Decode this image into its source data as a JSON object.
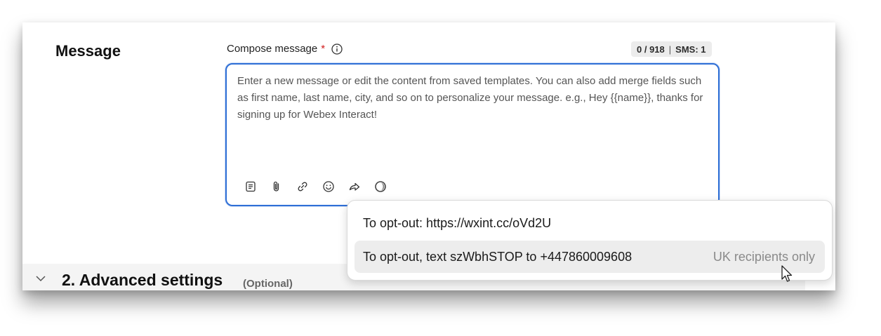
{
  "section": {
    "title": "Message"
  },
  "compose": {
    "label": "Compose message",
    "required_mark": "*",
    "info_icon": "info-icon",
    "counter_chars": "0 / 918",
    "counter_sms": "SMS: 1",
    "placeholder": "Enter a new message or edit the content from saved templates. You can also add merge fields such as first name, last name, city, and so on to personalize your message. e.g., Hey {{name}}, thanks for signing up for Webex Interact!",
    "toolbar_icons": [
      "template-icon",
      "attachment-icon",
      "link-icon",
      "emoji-icon",
      "opt-out-icon",
      "ai-assist-icon"
    ]
  },
  "optout_menu": {
    "items": [
      {
        "label": "To opt-out: https://wxint.cc/oVd2U",
        "hint": ""
      },
      {
        "label": "To opt-out, text szWbhSTOP to +447860009608",
        "hint": "UK recipients only"
      }
    ]
  },
  "advanced": {
    "title": "2. Advanced settings",
    "optional": "(Optional)"
  },
  "colors": {
    "focus_border": "#2f6fd6",
    "required": "#d11b1b",
    "hover_row": "#ededed"
  }
}
